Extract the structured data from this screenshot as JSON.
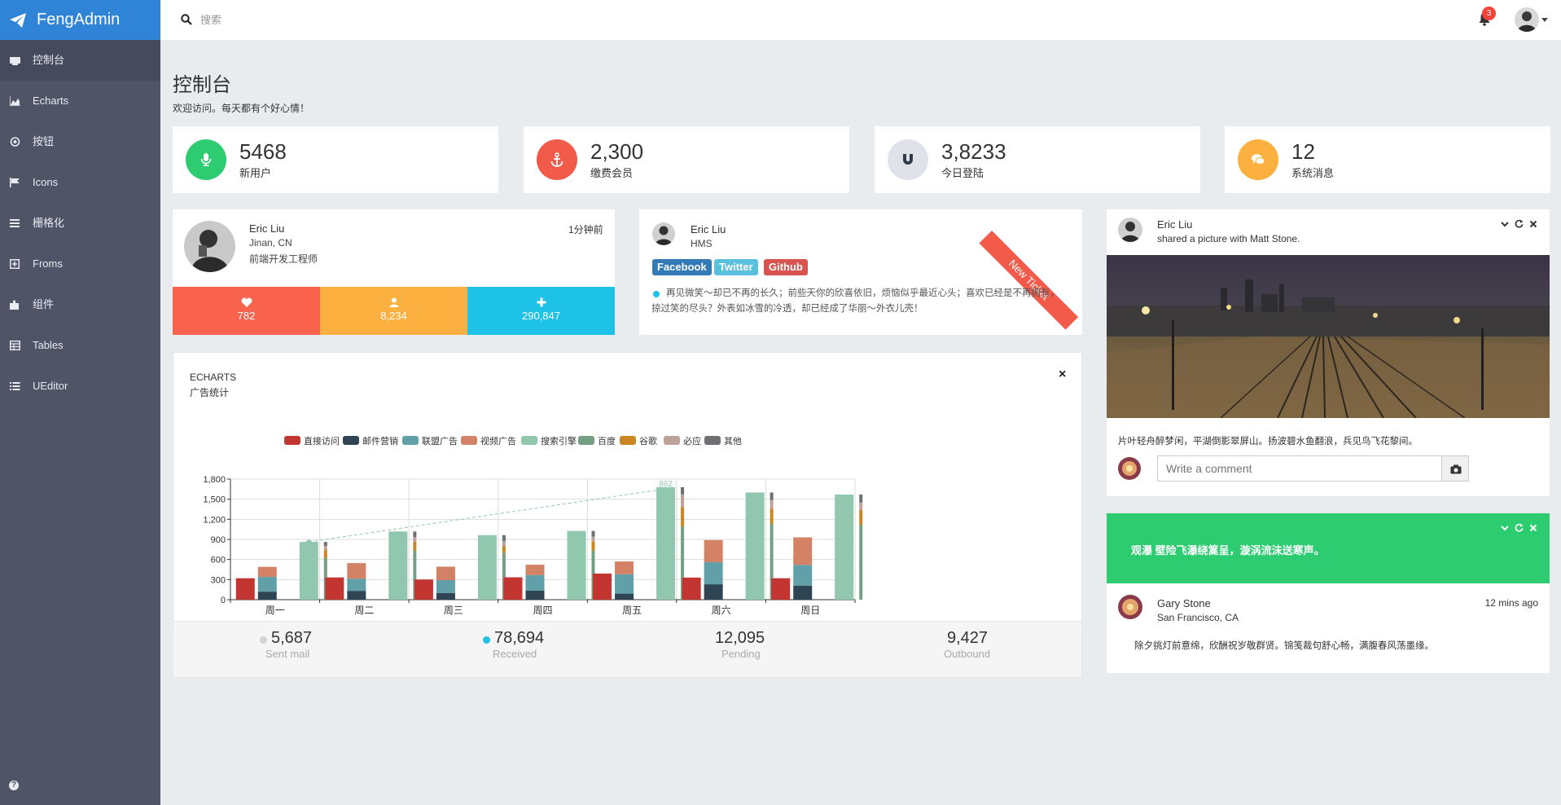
{
  "app": {
    "brand": "FengAdmin"
  },
  "sidebar": {
    "items": [
      {
        "label": "控制台",
        "icon": "dashboard-icon"
      },
      {
        "label": "Echarts",
        "icon": "area-chart-icon"
      },
      {
        "label": "按钮",
        "icon": "circle-dot-icon"
      },
      {
        "label": "Icons",
        "icon": "flag-icon"
      },
      {
        "label": "栅格化",
        "icon": "bars-icon"
      },
      {
        "label": "Froms",
        "icon": "plus-square-icon"
      },
      {
        "label": "组件",
        "icon": "puzzle-icon"
      },
      {
        "label": "Tables",
        "icon": "table-icon"
      },
      {
        "label": "UEditor",
        "icon": "list-icon"
      }
    ],
    "help_icon": "question-icon"
  },
  "topbar": {
    "search_placeholder": "搜索",
    "notification_count": "3"
  },
  "header": {
    "title": "控制台",
    "subtitle": "欢迎访问。每天都有个好心情！"
  },
  "stats": [
    {
      "value": "5468",
      "label": "新用户",
      "color": "#2ecc71",
      "icon": "microphone-icon"
    },
    {
      "value": "2,300",
      "label": "缴费会员",
      "color": "#f25a4a",
      "icon": "anchor-icon"
    },
    {
      "value": "3,8233",
      "label": "今日登陆",
      "color": "#dfe3e9",
      "icon": "magnet-icon"
    },
    {
      "value": "12",
      "label": "系统消息",
      "color": "#fbb040",
      "icon": "comments-icon"
    }
  ],
  "profile": {
    "name": "Eric Liu",
    "location": "Jinan, CN",
    "role": "前端开发工程师",
    "time": "1分钟前",
    "stats": [
      {
        "value": "782",
        "icon": "heart-icon",
        "color": "#f9634d"
      },
      {
        "value": "8,234",
        "icon": "user-icon",
        "color": "#fbb040"
      },
      {
        "value": "290,847",
        "icon": "plus-icon",
        "color": "#1ec2e6"
      }
    ]
  },
  "post": {
    "name": "Eric Liu",
    "org": "HMS",
    "tags": [
      {
        "label": "Facebook",
        "color": "#337ab7"
      },
      {
        "label": "Twitter",
        "color": "#5bc0de"
      },
      {
        "label": "Github",
        "color": "#d9534f"
      }
    ],
    "ribbon": "New Ticket",
    "text": "再见微笑～却已不再的长久；前些天你的欣喜依旧，烦恼似乎最近心头；喜欢已经是不再拥有，掠过笑的尽头？外表如冰雪的冷透，却已经成了华丽～外衣儿壳！"
  },
  "chart_card": {
    "title": "ECHARTS",
    "subtitle": "广告统计",
    "close": "×",
    "footer": [
      {
        "value": "5,687",
        "label": "Sent mail",
        "dot": "#d0d3d8"
      },
      {
        "value": "78,694",
        "label": "Received",
        "dot": "#1ec2e6"
      },
      {
        "value": "12,095",
        "label": "Pending"
      },
      {
        "value": "9,427",
        "label": "Outbound"
      }
    ]
  },
  "chart_data": {
    "type": "bar",
    "categories": [
      "周一",
      "周二",
      "周三",
      "周四",
      "周五",
      "周六",
      "周日"
    ],
    "ylim": [
      0,
      1800
    ],
    "yticks": [
      "0",
      "300",
      "600",
      "900",
      "1,200",
      "1,500",
      "1,800"
    ],
    "grid": true,
    "legend_position": "top",
    "series": [
      {
        "name": "直接访问",
        "color": "#c23531",
        "group": "a",
        "values": [
          320,
          332,
          301,
          334,
          390,
          330,
          320
        ]
      },
      {
        "name": "邮件营销",
        "color": "#2f4554",
        "group": "b",
        "values": [
          120,
          132,
          101,
          134,
          90,
          230,
          210
        ]
      },
      {
        "name": "联盟广告",
        "color": "#61a0a8",
        "group": "b",
        "values": [
          220,
          182,
          191,
          234,
          290,
          330,
          310
        ]
      },
      {
        "name": "视频广告",
        "color": "#d48265",
        "group": "b",
        "values": [
          150,
          232,
          201,
          154,
          190,
          330,
          410
        ]
      },
      {
        "name": "搜索引擎",
        "color": "#91c7ae",
        "group": "c",
        "values": [
          862,
          1018,
          964,
          1026,
          1679,
          1600,
          1570
        ]
      },
      {
        "name": "百度",
        "color": "#749f83",
        "group": "d",
        "values": [
          620,
          732,
          701,
          734,
          1090,
          1130,
          1120
        ]
      },
      {
        "name": "谷歌",
        "color": "#ca8622",
        "group": "d",
        "values": [
          120,
          132,
          101,
          134,
          290,
          230,
          220
        ]
      },
      {
        "name": "必应",
        "color": "#bda29a",
        "group": "d",
        "values": [
          60,
          72,
          71,
          74,
          190,
          130,
          110
        ]
      },
      {
        "name": "其他",
        "color": "#6e7074",
        "group": "d",
        "values": [
          62,
          82,
          91,
          84,
          109,
          110,
          120
        ]
      }
    ],
    "markline": {
      "from": 0,
      "to": 4,
      "label": "862"
    }
  },
  "photo_card": {
    "name": "Eric Liu",
    "action": "shared a picture with Matt Stone.",
    "caption": "片叶轻舟醉梦闲，平湖倒影翠屏山。扬波碧水鱼翻浪，兵见鸟飞花黎间。",
    "comment_placeholder": "Write a comment",
    "controls": [
      "chevron-down-icon",
      "refresh-icon",
      "close-icon"
    ]
  },
  "green_card": {
    "banner": "观瀑 壁险飞瀑绕篙呈，漩涡流沫送寒声。",
    "name": "Gary Stone",
    "location": "San Francisco, CA",
    "time": "12 mins ago",
    "text": "除夕挑灯前意绵，欣酬祝岁敬群贤。锦笺裁句舒心畅，满腹春风荡墨缘。"
  }
}
